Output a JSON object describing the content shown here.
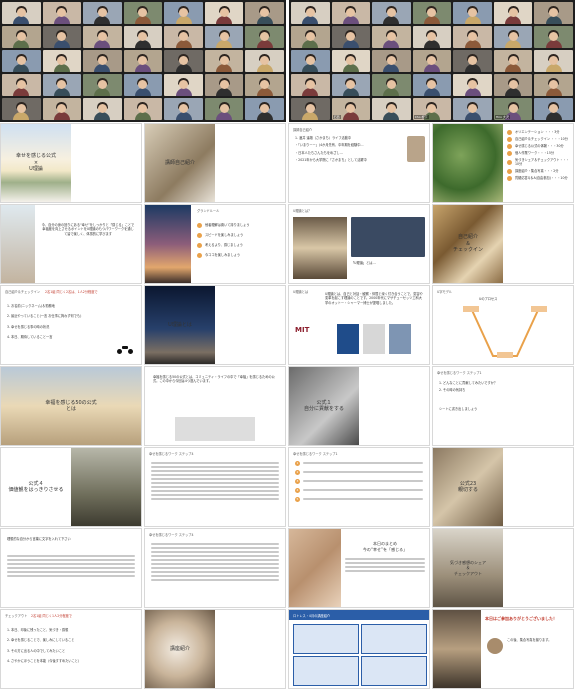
{
  "gallery": {
    "left_names": [
      "",
      "",
      "",
      "",
      "",
      "",
      "",
      "",
      "",
      "",
      "",
      "",
      "",
      "",
      "",
      "",
      "",
      "",
      "",
      "",
      "",
      "",
      "",
      "",
      "",
      "",
      "",
      "",
      "",
      "",
      "",
      "",
      "",
      ""
    ],
    "right_names": [
      "",
      "",
      "",
      "",
      "",
      "",
      "",
      "",
      "",
      "",
      "",
      "",
      "",
      "",
      "",
      "",
      "",
      "",
      "",
      "",
      "",
      "",
      "",
      "",
      "",
      "",
      "",
      "",
      "",
      "",
      "",
      "",
      "",
      "",
      ""
    ],
    "right_labels": [
      "石西",
      "Cho 松下",
      "Hiro 大沢"
    ]
  },
  "slides": {
    "s1": {
      "title_line1": "幸せを感じる公式",
      "title_line2": "×",
      "title_line3": "U理論"
    },
    "s2": {
      "title": "講師自己紹介"
    },
    "s3": {
      "header": "講師自己紹介",
      "lines": [
        "1. 酒井 達雄（さかまち）ライフ活動中",
        "・「いまりーー」(4か月先有、中年期を経験中…",
        "・日本人たちさんたちをめざし…",
        "・2021年から大学院に「さかまち」として活躍中"
      ]
    },
    "s4": {
      "items": [
        "オリエンテーション ・・・3分",
        "自己紹介＆チェックイン ・・・10分",
        "幸せ感じる公式の体験・・・30分",
        "個人作業ワーク・・・15分",
        "気づきシェア＆チェックアウト・・・10分",
        "講座紹介・集合写真・・・2分",
        "質疑応答Q＆A(自由参加)・・・10分"
      ]
    },
    "s5": {
      "label": "本日の流れ",
      "body": "今、自分の身の回りにある“幸せ”をしっかりと「感じる」ことで幸福度を向上させるポイントをU理論のもつパワーワークを通して皆で楽しく、体感的に学びます"
    },
    "s6": {
      "label": "グランドルール",
      "items": [
        "他者理解は置いて持りましょう",
        "スピードを楽しみましょう",
        "考えるより、感じましょう",
        "今ココを楽しみましょう"
      ]
    },
    "s7": {
      "header": "U理論とは？",
      "caption": "「U理論」とは…"
    },
    "s8": {
      "title": "自己紹介",
      "amp": "＆",
      "sub": "チェックイン"
    },
    "s9": {
      "header": "自己紹介＆チェックイン",
      "small": "2名1組 同じく2名は、1人2分程度で",
      "items": [
        "1. お名前(ニックネーム)＆勤務地",
        "2. 最近やっていること(一言 お仕事に拘わず何でも)",
        "3. 幸せを感じる事の時の状況",
        "4. 本日、期待していること一言"
      ]
    },
    "s10": {
      "title": "U理論とは"
    },
    "s11": {
      "header": "U理論とは",
      "body": "U理論とは、自己と対話・観察・仲間と深く付き合うことで、変容や変革を起こす理論のことです。2000年代にマサチューセッツ工科大学のオットー・シャーマー博士が提唱しました。",
      "logo": "MIT"
    },
    "s12": {
      "header": "U字モデル",
      "label": "Uのプロセス"
    },
    "s13": {
      "title_line1": "幸福を感じる50の公式",
      "title_line2": "とは"
    },
    "s14": {
      "body": "幸福を感じる50の公式とは、コミュニティ・ライフの中で「幸福」を感じるための公式。この中から今回は4つ選んでいます。"
    },
    "s15": {
      "title_line1": "公式１",
      "title_line2": "自分に貢献をする"
    },
    "s16": {
      "header": "幸せを感じるワーク ステップ1",
      "items": [
        "1. どんなことに貢献してみたいですか？",
        "2. その時の気持ち",
        "シートに書き出しましょう"
      ]
    },
    "s17": {
      "title_line1": "公式４",
      "title_line2": "価値観をはっきりさせる"
    },
    "s18": {
      "header": "幸せを感じるワーク ステップ4"
    },
    "s19": {
      "header": "幸せを感じるワーク ステップ1"
    },
    "s20": {
      "title_line1": "公式23",
      "title_line2": "親切する"
    },
    "s21": {
      "body": "理想的な自分から言葉に文字を入れて下さい"
    },
    "s22": {
      "header": "幸せを感じるワーク ステップ4"
    },
    "s23": {
      "title_line1": "本日のまとめ",
      "title_line2": "今の“幸せ”を「感じる」"
    },
    "s24": {
      "title_line1": "気づき感想のシェア",
      "title_line2": "＆",
      "title_line3": "チェックアウト"
    },
    "s25": {
      "header": "チェックアウト",
      "small": "2名1組 同じく1人2分程度で",
      "items": [
        "1. 本日、印象に残ったこと、気づき・感想",
        "2. 幸せを感じることで、楽しみにしていること",
        "3. その方に出る人の中でしてみたいこと",
        "4. さやかにほうことを本能（今後すすめたいこと）"
      ]
    },
    "s26": {
      "title": "講座紹介"
    },
    "s27": {
      "header": "ロトレス・4月の講座紹介"
    },
    "s28": {
      "thanks": "本日はご参加ありがとうございました！",
      "body": "この後、集合写真を撮ります。"
    }
  },
  "colors": {
    "accent": "#e9a14a",
    "zoom_bg": "#1e1e1e",
    "tag": "#333333",
    "blue": "#2b5ea8"
  }
}
